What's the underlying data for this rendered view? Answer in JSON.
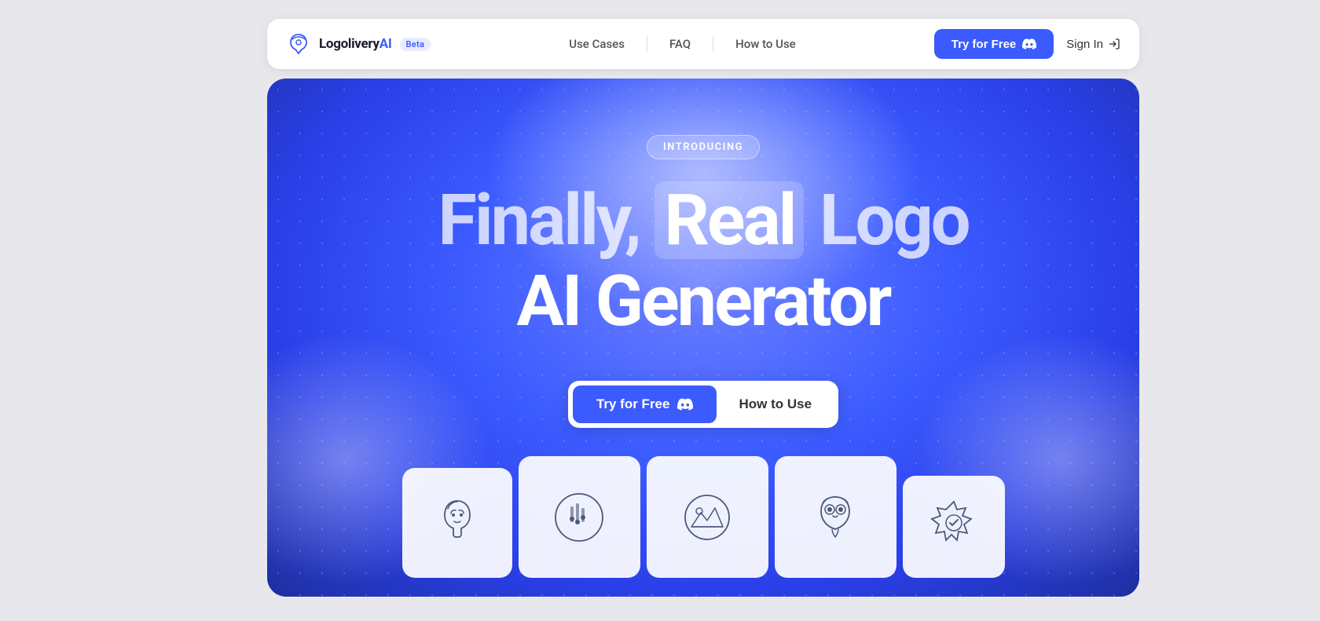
{
  "navbar": {
    "logo_text": "LogoliveryAI",
    "beta_label": "Beta",
    "nav_links": [
      {
        "label": "Use Cases",
        "id": "use-cases"
      },
      {
        "label": "FAQ",
        "id": "faq"
      },
      {
        "label": "How to Use",
        "id": "how-to-use"
      }
    ],
    "try_free_label": "Try for Free",
    "sign_in_label": "Sign In"
  },
  "hero": {
    "introducing_label": "INTRODUCING",
    "title_line1_prefix": "Finally,",
    "title_line1_highlight": "Real",
    "title_line1_suffix": "Logo",
    "title_line2": "AI Generator",
    "cta_primary": "Try for Free",
    "cta_secondary": "How to Use"
  },
  "logos": [
    {
      "id": "face",
      "alt": "Portrait face logo"
    },
    {
      "id": "equalizer",
      "alt": "Equalizer logo"
    },
    {
      "id": "landscape",
      "alt": "Landscape logo"
    },
    {
      "id": "owl",
      "alt": "Owl logo"
    },
    {
      "id": "badge",
      "alt": "Badge logo"
    }
  ],
  "colors": {
    "primary": "#3b5bff",
    "text_dark": "#1a1a2e",
    "background": "#e8e8ec"
  }
}
